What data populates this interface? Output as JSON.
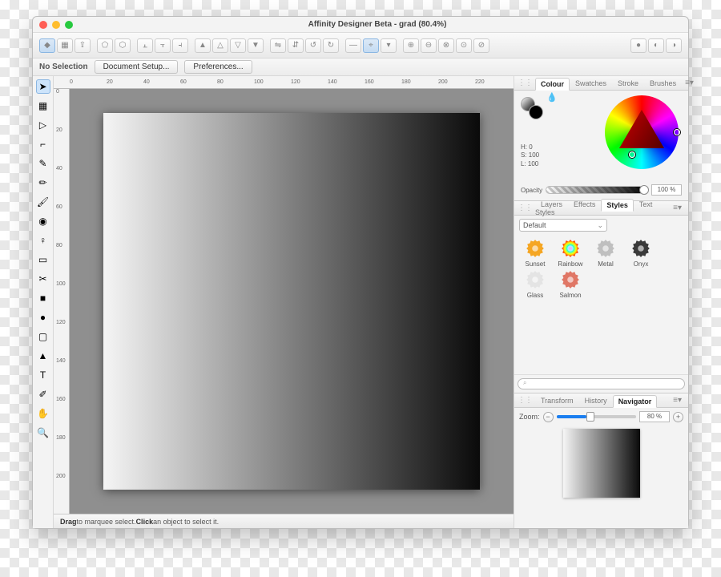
{
  "window": {
    "title": "Affinity Designer Beta - grad (80.4%)"
  },
  "context": {
    "selection": "No Selection",
    "docsetup": "Document Setup...",
    "prefs": "Preferences..."
  },
  "ruler": {
    "unit": "mm",
    "hmarks": [
      "0",
      "20",
      "40",
      "60",
      "80",
      "100",
      "120",
      "140",
      "160",
      "180",
      "200",
      "220"
    ],
    "vmarks": [
      "0",
      "20",
      "40",
      "60",
      "80",
      "100",
      "120",
      "140",
      "160",
      "180",
      "200"
    ]
  },
  "status": {
    "b1": "Drag",
    "t1": " to marquee select. ",
    "b2": "Click",
    "t2": " an object to select it."
  },
  "panels": {
    "color": {
      "tabs": [
        "Colour",
        "Swatches",
        "Stroke",
        "Brushes"
      ],
      "active": 0,
      "h": "H: 0",
      "s": "S: 100",
      "l": "L: 100",
      "opacity_label": "Opacity",
      "opacity_value": "100 %"
    },
    "styles": {
      "tabs": [
        "Layers",
        "Effects",
        "Styles",
        "Text Styles"
      ],
      "active": 2,
      "preset": "Default",
      "items": [
        {
          "label": "Sunset",
          "fill": "#f5a623"
        },
        {
          "label": "Rainbow",
          "fill": "rainbow"
        },
        {
          "label": "Metal",
          "fill": "#bfbfbf"
        },
        {
          "label": "Onyx",
          "fill": "#3a3a3a"
        },
        {
          "label": "Glass",
          "fill": "#e4e4e4"
        },
        {
          "label": "Salmon",
          "fill": "#e07766"
        }
      ],
      "search_placeholder": "⌕"
    },
    "nav": {
      "tabs": [
        "Transform",
        "History",
        "Navigator"
      ],
      "active": 2,
      "zoom_label": "Zoom:",
      "zoom_value": "80 %"
    }
  },
  "tools": [
    {
      "name": "move-tool",
      "glyph": "➤",
      "sel": true
    },
    {
      "name": "artboard-tool",
      "glyph": "▦"
    },
    {
      "name": "node-tool",
      "glyph": "▷"
    },
    {
      "name": "corner-tool",
      "glyph": "⌐"
    },
    {
      "name": "pen-tool",
      "glyph": "✎"
    },
    {
      "name": "pencil-tool",
      "glyph": "✏"
    },
    {
      "name": "brush-tool",
      "glyph": "🖌"
    },
    {
      "name": "fill-tool",
      "glyph": "◉"
    },
    {
      "name": "transparency-tool",
      "glyph": "♀"
    },
    {
      "name": "place-tool",
      "glyph": "▭"
    },
    {
      "name": "crop-tool",
      "glyph": "✂"
    },
    {
      "name": "rectangle-tool",
      "glyph": "■"
    },
    {
      "name": "ellipse-tool",
      "glyph": "●"
    },
    {
      "name": "rounded-tool",
      "glyph": "▢"
    },
    {
      "name": "triangle-tool",
      "glyph": "▲"
    },
    {
      "name": "text-tool",
      "glyph": "T"
    },
    {
      "name": "color-picker-tool",
      "glyph": "✐"
    },
    {
      "name": "hand-tool",
      "glyph": "✋"
    },
    {
      "name": "zoom-tool",
      "glyph": "🔍"
    }
  ]
}
